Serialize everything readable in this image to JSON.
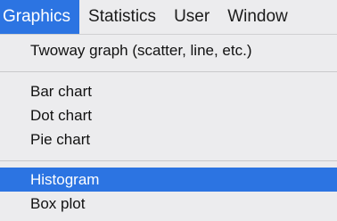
{
  "menubar": {
    "items": [
      "Graphics",
      "Statistics",
      "User",
      "Window"
    ]
  },
  "dropdown": {
    "items": [
      "Twoway graph (scatter, line, etc.)",
      "Bar chart",
      "Dot chart",
      "Pie chart",
      "Histogram",
      "Box plot"
    ],
    "highlighted": "Histogram",
    "highlight_color": "#2c74e2"
  }
}
